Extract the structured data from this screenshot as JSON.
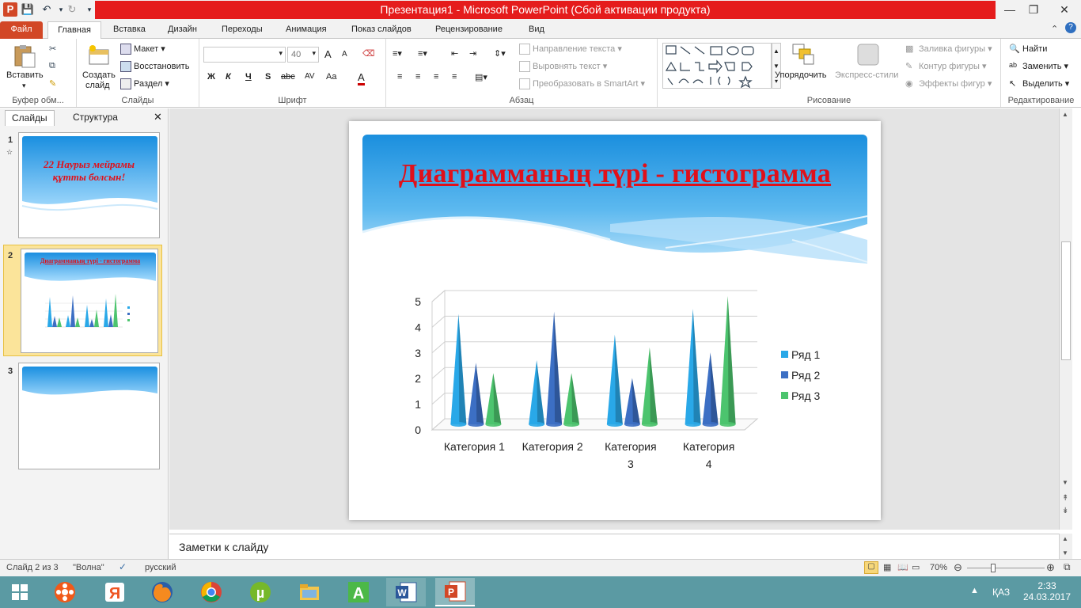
{
  "window": {
    "title": "Презентация1  -  Microsoft PowerPoint (Сбой активации продукта)"
  },
  "tabs": [
    "Файл",
    "Главная",
    "Вставка",
    "Дизайн",
    "Переходы",
    "Анимация",
    "Показ слайдов",
    "Рецензирование",
    "Вид"
  ],
  "ribbon": {
    "clipboard": {
      "paste": "Вставить",
      "label": "Буфер обм..."
    },
    "slides": {
      "create": "Создать",
      "create2": "слайд",
      "layout": "Макет",
      "reset": "Восстановить",
      "section": "Раздел",
      "label": "Слайды"
    },
    "font": {
      "size": "40",
      "label": "Шрифт",
      "bold": "Ж",
      "italic": "К",
      "underline": "Ч",
      "strike": "S",
      "shadow": "abc",
      "spacing": "AV",
      "case": "Aa",
      "grow": "A",
      "shrink": "A",
      "color": "A"
    },
    "paragraph": {
      "dir": "Направление текста",
      "align": "Выровнять текст",
      "smartart": "Преобразовать в SmartArt",
      "label": "Абзац"
    },
    "drawing": {
      "arrange": "Упорядочить",
      "quickstyles": "Экспресс-стили",
      "fill": "Заливка фигуры",
      "outline": "Контур фигуры",
      "effects": "Эффекты фигур",
      "label": "Рисование"
    },
    "editing": {
      "find": "Найти",
      "replace": "Заменить",
      "select": "Выделить",
      "label": "Редактирование"
    }
  },
  "leftpanel": {
    "tab_slides": "Слайды",
    "tab_outline": "Структура",
    "slides": [
      {
        "num": "1",
        "title_line1": "22 Наурыз мейрамы",
        "title_line2": "құтты болсын!"
      },
      {
        "num": "2",
        "title": "Диаграмманың түрі - гистограмма"
      },
      {
        "num": "3"
      }
    ]
  },
  "slide": {
    "title": "Диаграмманың түрі - гистограмма"
  },
  "chart_data": {
    "type": "bar",
    "title": "",
    "categories": [
      "Категория 1",
      "Категория 2",
      "Категория 3",
      "Категория 4"
    ],
    "category_lines": [
      [
        "Категория 1"
      ],
      [
        "Категория 2"
      ],
      [
        "Категория",
        "3"
      ],
      [
        "Категория",
        "4"
      ]
    ],
    "series": [
      {
        "name": "Ряд 1",
        "values": [
          4.3,
          2.5,
          3.5,
          4.5
        ],
        "color": "#29a8e8"
      },
      {
        "name": "Ряд 2",
        "values": [
          2.4,
          4.4,
          1.8,
          2.8
        ],
        "color": "#3c6fc4"
      },
      {
        "name": "Ряд 3",
        "values": [
          2,
          2,
          3,
          5
        ],
        "color": "#4cc46e"
      }
    ],
    "ylim": [
      0,
      5
    ],
    "yticks": [
      "0",
      "1",
      "2",
      "3",
      "4",
      "5"
    ],
    "shape": "3D cone/pyramid columns",
    "grid": true,
    "legend": "right"
  },
  "notes": {
    "placeholder": "Заметки к слайду"
  },
  "status": {
    "slide": "Слайд 2 из 3",
    "theme": "\"Волна\"",
    "lang": "русский",
    "zoom": "70%"
  },
  "taskbar": {
    "lang": "ҚАЗ",
    "time": "2:33",
    "date": "24.03.2017"
  }
}
